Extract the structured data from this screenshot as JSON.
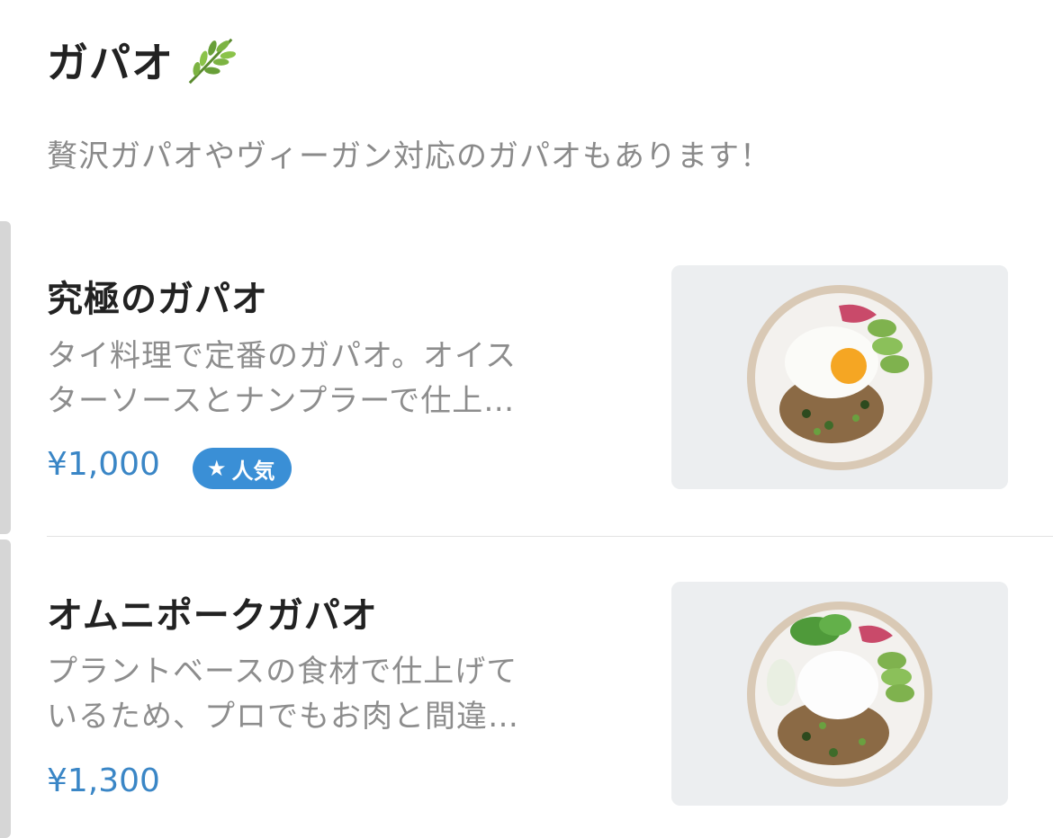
{
  "section": {
    "title": "ガパオ",
    "icon": "herb-icon",
    "subtitle": "贅沢ガパオやヴィーガン対応のガパオもあります！"
  },
  "items": [
    {
      "name": "究極のガパオ",
      "desc_line1": "タイ料理で定番のガパオ。オイス",
      "desc_line2": "ターソースとナンプラーで仕上…",
      "price": "¥1,000",
      "badge": "人気",
      "badge_icon": "star-icon"
    },
    {
      "name": "オムニポークガパオ",
      "desc_line1": "プラントベースの食材で仕上げて",
      "desc_line2": "いるため、プロでもお肉と間違…",
      "price": "¥1,300"
    }
  ],
  "colors": {
    "price": "#3a86c6",
    "badge_bg": "#3a8fd6"
  }
}
